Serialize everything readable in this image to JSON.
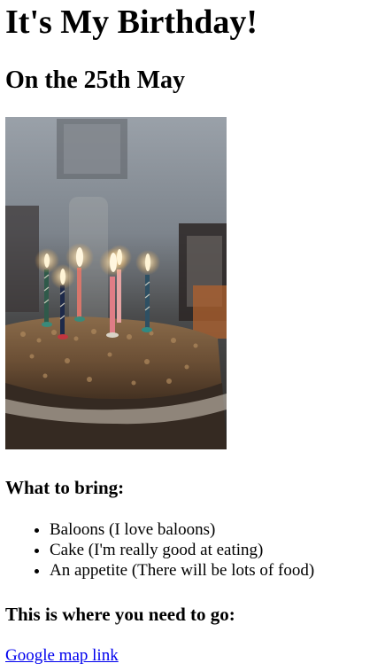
{
  "header": {
    "title": "It's My Birthday!",
    "date": "On the 25th May"
  },
  "photo": {
    "subject": "birthday cake with lit candles"
  },
  "bring": {
    "heading": "What to bring:",
    "items": [
      "Baloons (I love baloons)",
      "Cake (I'm really good at eating)",
      "An appetite (There will be lots of food)"
    ]
  },
  "location": {
    "heading": "This is where you need to go:",
    "link_label": "Google map link"
  },
  "colors": {
    "link": "#0000ee",
    "text": "#000000",
    "background": "#ffffff"
  }
}
